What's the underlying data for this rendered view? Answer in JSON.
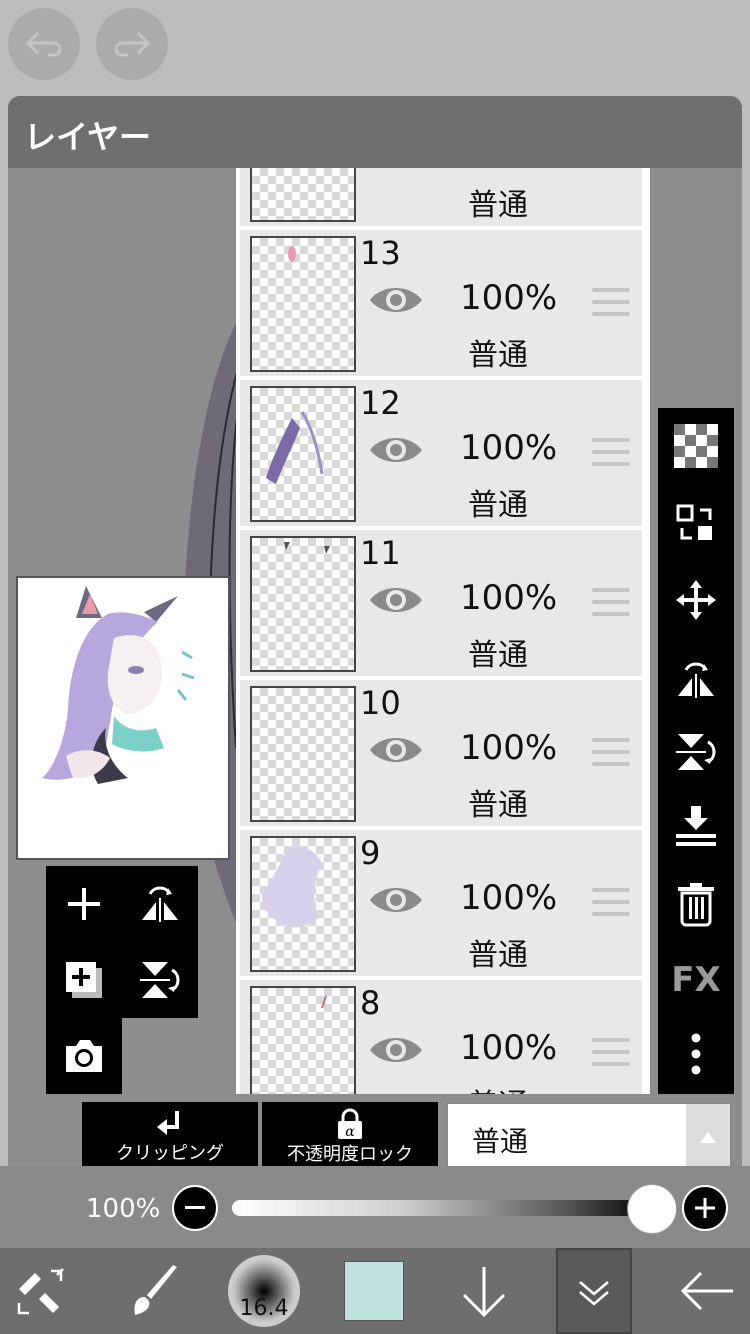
{
  "panel": {
    "title": "レイヤー"
  },
  "layers": [
    {
      "name": "",
      "opacity": "",
      "blend": "普通"
    },
    {
      "name": "13",
      "opacity": "100%",
      "blend": "普通"
    },
    {
      "name": "12",
      "opacity": "100%",
      "blend": "普通"
    },
    {
      "name": "11",
      "opacity": "100%",
      "blend": "普通"
    },
    {
      "name": "10",
      "opacity": "100%",
      "blend": "普通"
    },
    {
      "name": "9",
      "opacity": "100%",
      "blend": "普通"
    },
    {
      "name": "8",
      "opacity": "100%",
      "blend": "普通"
    }
  ],
  "right_toolbar": {
    "icons": [
      "transparency-icon",
      "swap-icon",
      "move-icon",
      "flip-horizontal-icon",
      "flip-vertical-icon",
      "merge-down-icon",
      "trash-icon",
      "fx-icon",
      "more-icon"
    ],
    "fx_label": "FX"
  },
  "left_tools": {
    "icons": [
      "add-layer-icon",
      "flip-h-icon",
      "add-copy-icon",
      "flip-v-icon",
      "camera-icon"
    ]
  },
  "mode_buttons": {
    "clipping_label": "クリッピング",
    "alpha_lock_label": "不透明度ロック"
  },
  "blend_select": {
    "value": "普通"
  },
  "opacity_slider": {
    "label": "100%",
    "value": 1.0
  },
  "bottom_bar": {
    "brush_size": "16.4",
    "color": "#c2e2e0",
    "icons": [
      "transform-icon",
      "brush-icon",
      "brush-size-icon",
      "color-swatch",
      "down-arrow-icon",
      "collapse-icon",
      "back-icon"
    ]
  },
  "colors": {
    "accent_black": "#000000",
    "panel_bg": "#7c7c7c",
    "row_bg": "#e8e8e8"
  }
}
